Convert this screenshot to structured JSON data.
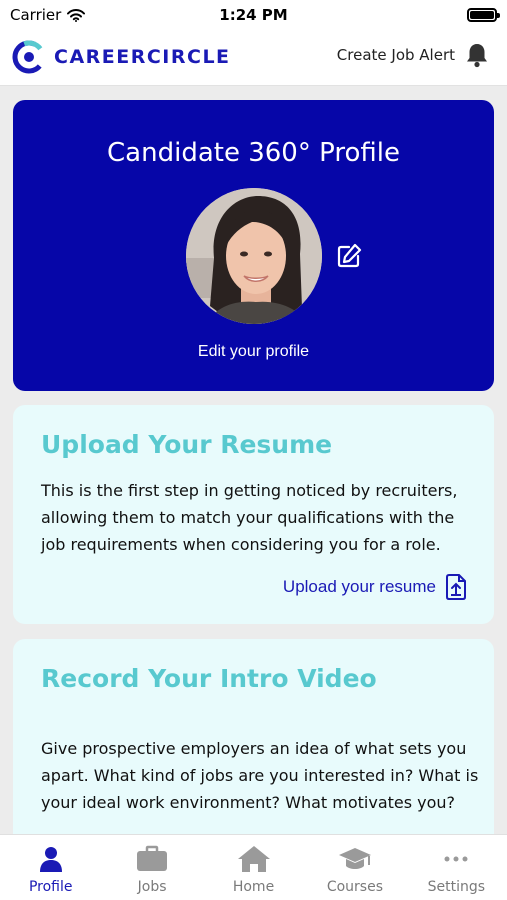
{
  "status_bar": {
    "carrier": "Carrier",
    "time": "1:24 PM"
  },
  "header": {
    "brand": "CAREERCIRCLE",
    "alert_label": "Create Job Alert"
  },
  "profile_card": {
    "title": "Candidate 360° Profile",
    "edit_label": "Edit your profile"
  },
  "resume_card": {
    "title": "Upload Your Resume",
    "body": "This is the first step in getting noticed by recruiters, allowing them to match your qualifications with the job requirements when considering you for a role.",
    "link_label": "Upload your resume"
  },
  "video_card": {
    "title": "Record Your Intro Video",
    "body": "Give prospective employers an idea of what sets you apart. What kind of jobs are you interested in? What is your ideal work environment? What motivates you?"
  },
  "tabs": [
    {
      "label": "Profile",
      "icon": "person-icon",
      "active": true
    },
    {
      "label": "Jobs",
      "icon": "briefcase-icon"
    },
    {
      "label": "Home",
      "icon": "home-icon"
    },
    {
      "label": "Courses",
      "icon": "graduation-cap-icon"
    },
    {
      "label": "Settings",
      "icon": "more-icon"
    }
  ],
  "colors": {
    "brand": "#0606a8",
    "accent": "#58c9cf",
    "card_bg": "#e8fbfc",
    "link": "#1a1ab5"
  }
}
